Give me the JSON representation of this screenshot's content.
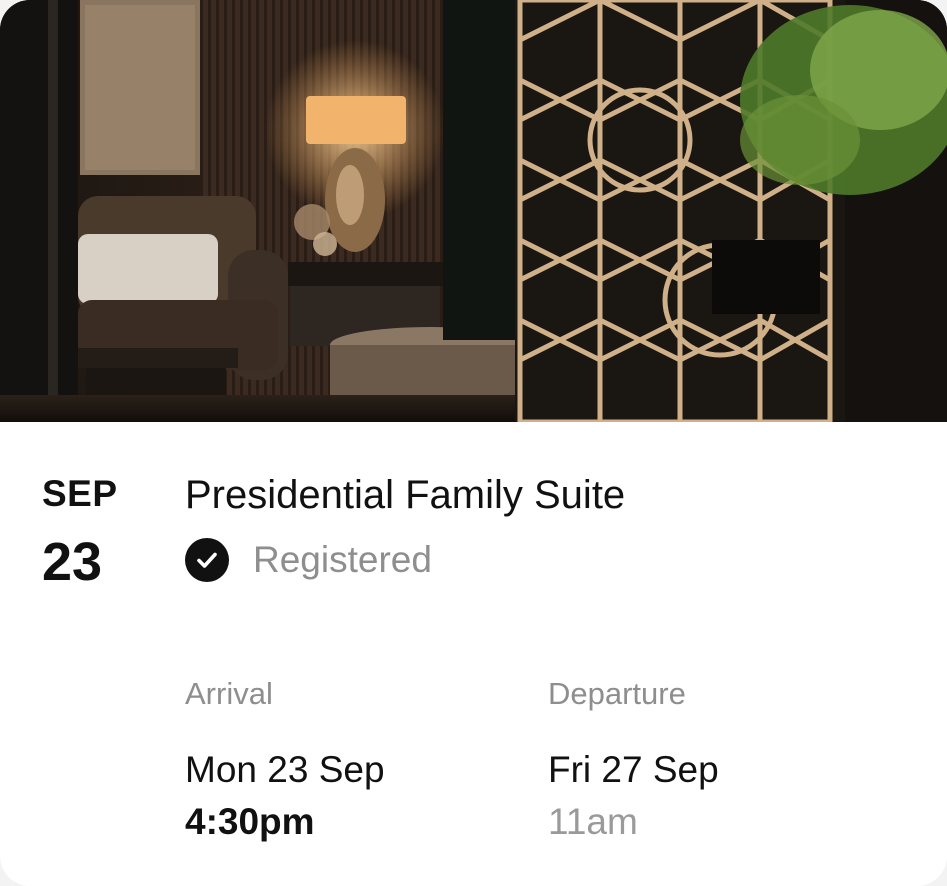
{
  "hero": {
    "image_description": "Hotel suite lounge photo with lamp, sofa and geometric screen"
  },
  "event": {
    "month": "SEP",
    "day": "23"
  },
  "room": {
    "title": "Presidential Family Suite",
    "status": "Registered",
    "status_icon": "check-circle-icon"
  },
  "arrival": {
    "label": "Arrival",
    "date": "Mon 23 Sep",
    "time": "4:30pm"
  },
  "departure": {
    "label": "Departure",
    "date": "Fri 27 Sep",
    "time": "11am"
  },
  "colors": {
    "text_primary": "#111111",
    "text_muted": "#8e8e8e",
    "card_background": "#ffffff"
  }
}
